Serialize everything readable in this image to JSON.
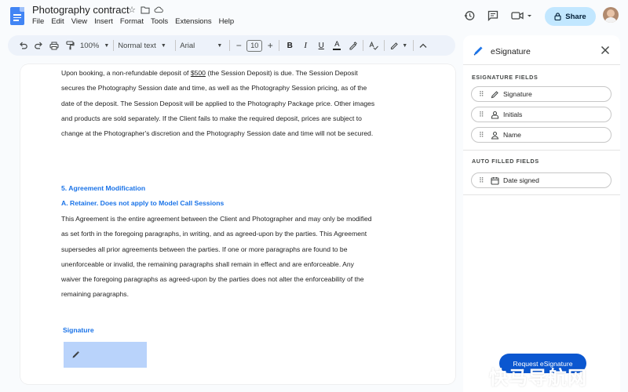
{
  "app": {
    "doc_title": "Photography contract",
    "menu": [
      "File",
      "Edit",
      "View",
      "Insert",
      "Format",
      "Tools",
      "Extensions",
      "Help"
    ],
    "share_label": "Share"
  },
  "toolbar": {
    "zoom": "100%",
    "style": "Normal text",
    "font": "Arial",
    "font_size": "10"
  },
  "document": {
    "para1": [
      "Upon booking, a non-refundable deposit of ",
      "$500",
      " (the Session Deposit) is due. The Session Deposit secures the Photography Session date and time, as well as the Photography Session pricing, as of the date of the deposit. The Session Deposit will be applied to the Photography Package price. Other images and products are sold separately. If the Client fails to make the required deposit, prices are subject to change at the Photographer's discretion and the Photography Session date and time will not be secured."
    ],
    "heading1": "5. Agreement Modification",
    "heading2": "A. Retainer.  Does not apply to Model Call Sessions",
    "para2": "This Agreement is the entire agreement between the Client and Photographer and may only be modified as set forth in the foregoing paragraphs, in writing, and as agreed-upon by the parties.  This Agreement supersedes all prior agreements between the parties. If one or more paragraphs are found to be unenforceable or invalid, the remaining paragraphs shall remain in effect and are enforceable. Any waiver the foregoing paragraphs as agreed-upon by the parties does not alter the enforceability of the remaining paragraphs.",
    "signature_heading": "Signature"
  },
  "panel": {
    "title": "eSignature",
    "section1_label": "ESIGNATURE FIELDS",
    "fields": [
      {
        "label": "Signature",
        "icon": "pen-icon"
      },
      {
        "label": "Initials",
        "icon": "person-badge-icon"
      },
      {
        "label": "Name",
        "icon": "person-icon"
      }
    ],
    "section2_label": "AUTO FILLED FIELDS",
    "auto_fields": [
      {
        "label": "Date signed",
        "icon": "calendar-icon"
      }
    ],
    "request_button": "Request eSignature"
  },
  "watermark": "快马导航网",
  "colors": {
    "accent_blue": "#1a73e8",
    "share_bg": "#c2e7ff",
    "primary_button": "#0b57d0",
    "signature_box": "#b9d3fb"
  }
}
